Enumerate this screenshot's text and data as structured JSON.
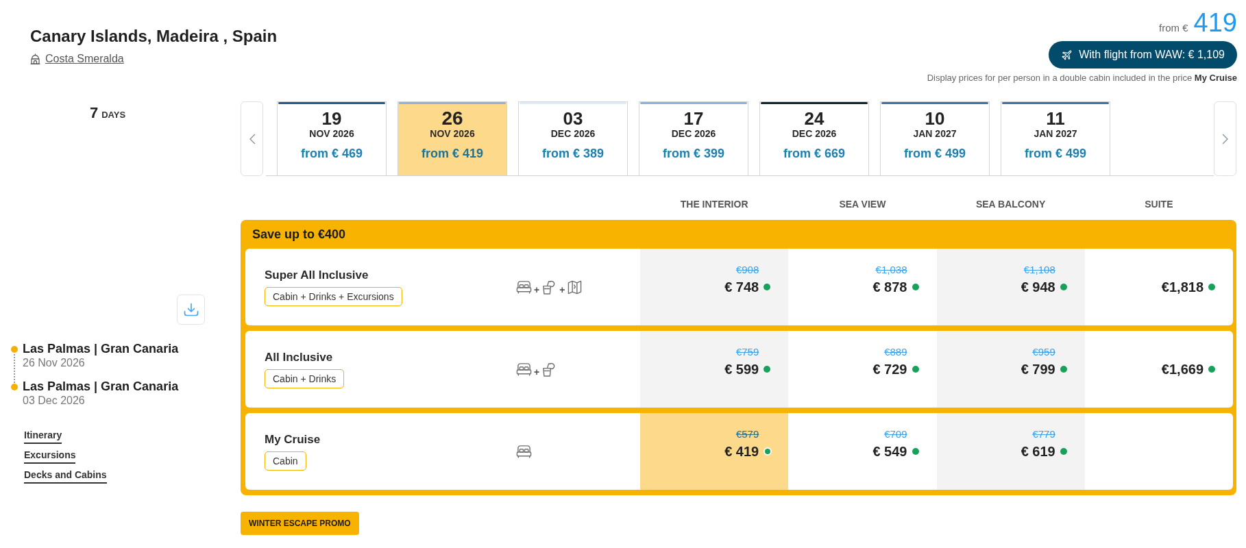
{
  "header": {
    "title": "Canary Islands, Madeira , Spain",
    "ship": "Costa Smeralda",
    "price_prefix": "from €",
    "price": "419",
    "flight_button": "With flight from WAW: € 1,109",
    "note": "Display prices for per person in a double cabin included in the price **My Cruise**"
  },
  "sidebar": {
    "duration_value": "7",
    "duration_unit": "DAYS",
    "route": [
      {
        "port": "Las Palmas | Gran Canaria",
        "date": "26 Nov 2026"
      },
      {
        "port": "Las Palmas | Gran Canaria",
        "date": "03 Dec 2026"
      }
    ],
    "links": [
      "Itinerary",
      "Excursions",
      "Decks and Cabins"
    ]
  },
  "dates": [
    {
      "day": "19",
      "month": "NOV 2026",
      "price": "from € 469",
      "color": "#215c8c",
      "selected": false
    },
    {
      "day": "26",
      "month": "NOV 2026",
      "price": "from € 419",
      "color": "#8db4dc",
      "selected": true
    },
    {
      "day": "03",
      "month": "DEC 2026",
      "price": "from € 389",
      "color": "#dcecf8",
      "selected": false
    },
    {
      "day": "17",
      "month": "DEC 2026",
      "price": "from € 399",
      "color": "#8ab2da",
      "selected": false
    },
    {
      "day": "24",
      "month": "DEC 2026",
      "price": "from € 669",
      "color": "#10232e",
      "selected": false
    },
    {
      "day": "10",
      "month": "JAN 2027",
      "price": "from € 499",
      "color": "#3b73a6",
      "selected": false
    },
    {
      "day": "11",
      "month": "JAN 2027",
      "price": "from € 499",
      "color": "#3b73a6",
      "selected": false
    }
  ],
  "columns": [
    "THE INTERIOR",
    "SEA VIEW",
    "SEA BALCONY",
    "SUITE"
  ],
  "offer": {
    "title": "Save up to €400",
    "packages": [
      {
        "name": "Super All Inclusive",
        "tag": "Cabin + Drinks + Excursions",
        "inclusions": [
          {
            "kind": "bed"
          },
          {
            "kind": "drink",
            "prefix": "+"
          },
          {
            "kind": "map",
            "prefix": "+"
          }
        ],
        "prices": [
          {
            "old": "€908",
            "price": "€ 748",
            "selected": false
          },
          {
            "old": "€1,038",
            "price": "€ 878",
            "selected": false
          },
          {
            "old": "€1,108",
            "price": "€ 948",
            "selected": false
          },
          {
            "price": "€1,818",
            "selected": false
          }
        ]
      },
      {
        "name": "All Inclusive",
        "tag": "Cabin + Drinks",
        "inclusions": [
          {
            "kind": "bed"
          },
          {
            "kind": "drink",
            "prefix": "+"
          }
        ],
        "prices": [
          {
            "old": "€759",
            "price": "€ 599",
            "selected": false
          },
          {
            "old": "€889",
            "price": "€ 729",
            "selected": false
          },
          {
            "old": "€959",
            "price": "€ 799",
            "selected": false
          },
          {
            "price": "€1,669",
            "selected": false
          }
        ]
      },
      {
        "name": "My Cruise",
        "tag": "Cabin",
        "inclusions": [
          {
            "kind": "bed"
          }
        ],
        "prices": [
          {
            "old": "€579",
            "price": "€ 419",
            "selected": true
          },
          {
            "old": "€709",
            "price": "€ 549",
            "selected": false
          },
          {
            "old": "€779",
            "price": "€ 619",
            "selected": false
          }
        ]
      }
    ]
  },
  "promo_badge": "WINTER ESCAPE PROMO"
}
